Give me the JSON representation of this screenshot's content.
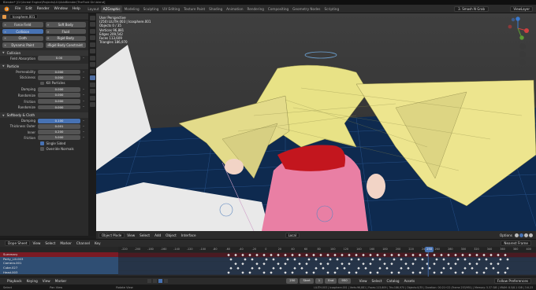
{
  "window": {
    "title": "Blender* [G:\\Unreal Engine\\Projects\\LIU\\AdvBlender\\TheFluid Girl.blend]"
  },
  "menu": {
    "items": [
      "File",
      "Edit",
      "Render",
      "Window",
      "Help"
    ],
    "workspaces": [
      "Layout",
      "AZGraphic",
      "Modeling",
      "Sculpting",
      "UV Editing",
      "Texture Paint",
      "Shading",
      "Animation",
      "Rendering",
      "Compositing",
      "Geometry Nodes",
      "Scripting"
    ],
    "active_workspace": "AZGraphic",
    "scene": "3. Smash N Grab",
    "view_layer": "ViewLayer"
  },
  "properties": {
    "object_name": "Icosphere.001",
    "physics_buttons": [
      [
        "Force Field",
        "Soft Body"
      ],
      [
        "Collision",
        "Fluid"
      ],
      [
        "Cloth",
        "Rigid Body"
      ],
      [
        "Dynamic Paint",
        "Rigid Body Constraint"
      ]
    ],
    "collision_section": "Collision",
    "field_absorption_label": "Field Absorption",
    "field_absorption_value": "0.00",
    "particle_section": "Particle",
    "permeability_label": "Permeability",
    "permeability_value": "0.000",
    "stickiness_label": "Stickiness",
    "stickiness_value": "0.000",
    "kill_particles_label": "Kill Particles",
    "damping_label": "Damping",
    "damping_value": "0.000",
    "randomize_label": "Randomize",
    "randomize_value": "0.000",
    "friction_label": "Friction",
    "friction_value": "0.000",
    "friction_randomize_label": "Randomize",
    "friction_randomize_value": "0.000",
    "softbody_section": "Softbody & Cloth",
    "sb_damping_label": "Damping",
    "sb_damping_value": "0.100",
    "thickness_outer_label": "Thickness Outer",
    "thickness_outer_value": "0.001",
    "inner_label": "Inner",
    "inner_value": "0.200",
    "sb_friction_label": "Friction",
    "sb_friction_value": "5.000",
    "single_sided_label": "Single Sided",
    "override_normals_label": "Override Normals"
  },
  "viewport": {
    "info_lines": [
      "User Perspective",
      "(250) LILITH.003 | Icosphere.001",
      "Objects    0 / 35",
      "Vertices   96,881",
      "Edges      209,542",
      "Faces      113,609",
      "Triangles  186,970"
    ],
    "mode": "Object Mode",
    "menu": [
      "View",
      "Select",
      "Add",
      "Object",
      "Interface"
    ],
    "orientation": "Local",
    "options": "Options"
  },
  "dopesheet": {
    "editor": "Dope Sheet",
    "menu": [
      "View",
      "Select",
      "Marker",
      "Channel",
      "Key"
    ],
    "snapping": "Nearest Frame",
    "channels": [
      {
        "name": "Summary",
        "kind": "sum"
      },
      {
        "name": "Party_Lili.003",
        "kind": "obj"
      },
      {
        "name": "Camera.001",
        "kind": "obj"
      },
      {
        "name": "Cube.027",
        "kind": "obj"
      },
      {
        "name": "Head.003",
        "kind": "obj"
      },
      {
        "name": "LILITH.003",
        "kind": "obj"
      }
    ],
    "ruler_ticks": [
      "-220",
      "-200",
      "-180",
      "-160",
      "-140",
      "-120",
      "-100",
      "-80",
      "-60",
      "-40",
      "-20",
      "0",
      "20",
      "40",
      "60",
      "80",
      "100",
      "120",
      "140",
      "160",
      "180",
      "200",
      "220",
      "240",
      "260",
      "280",
      "300",
      "320",
      "340",
      "360",
      "380",
      "400"
    ],
    "current_frame": "250"
  },
  "timeline": {
    "menu": [
      "Playback",
      "Keying",
      "View",
      "Marker"
    ],
    "frame_current": "250",
    "start_label": "Start",
    "start_value": "1",
    "end_label": "End",
    "end_value": "950",
    "right_menu": [
      "View",
      "Select",
      "Catalog",
      "Assets"
    ],
    "prefs": "Follow Preferences"
  },
  "status": {
    "left": [
      "Select",
      "Pan View",
      "Rotate View"
    ],
    "right": "LILITH.003 | Icosphere.001 | Verts:96,881 | Faces:113,609 | Tris:186,970 | Objects:0/35 | Duration: 00:21+22 (Frame 253/951) | Memory: 5.37 GiB | VRAM: 8.5/8.1 GiB | 3.6.23"
  }
}
